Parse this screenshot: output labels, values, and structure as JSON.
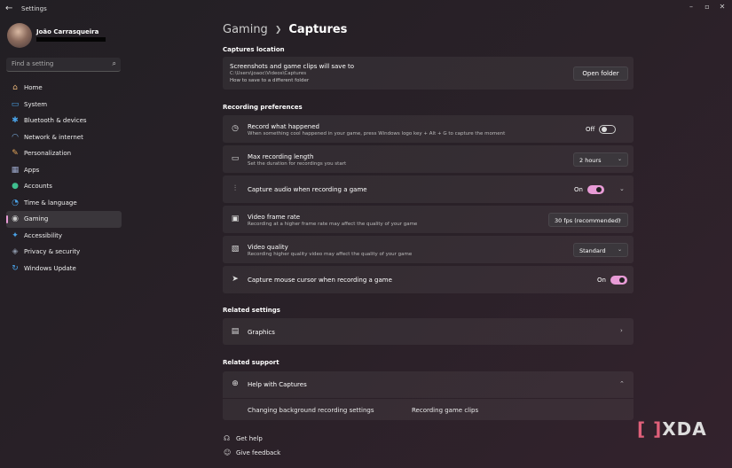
{
  "window": {
    "title": "Settings",
    "back_icon": "back-arrow-icon",
    "controls": [
      "minimize",
      "maximize",
      "close"
    ]
  },
  "profile": {
    "name": "João Carrasqueira"
  },
  "search": {
    "placeholder": "Find a setting"
  },
  "nav": [
    {
      "label": "Home",
      "icon": "home-icon",
      "glyph": "⌂",
      "color": "#e9b67a"
    },
    {
      "label": "System",
      "icon": "system-icon",
      "glyph": "▭",
      "color": "#4aa3e8"
    },
    {
      "label": "Bluetooth & devices",
      "icon": "bluetooth-icon",
      "glyph": "✱",
      "color": "#4aa3e8"
    },
    {
      "label": "Network & internet",
      "icon": "wifi-icon",
      "glyph": "◠",
      "color": "#7fb6ea"
    },
    {
      "label": "Personalization",
      "icon": "brush-icon",
      "glyph": "✎",
      "color": "#e8a85a"
    },
    {
      "label": "Apps",
      "icon": "apps-icon",
      "glyph": "▦",
      "color": "#9aa7c9"
    },
    {
      "label": "Accounts",
      "icon": "accounts-icon",
      "glyph": "●",
      "color": "#3fbf8f"
    },
    {
      "label": "Time & language",
      "icon": "globe-clock-icon",
      "glyph": "◔",
      "color": "#4aa3e8"
    },
    {
      "label": "Gaming",
      "icon": "gamepad-icon",
      "glyph": "◉",
      "color": "#c9c9c9",
      "selected": true
    },
    {
      "label": "Accessibility",
      "icon": "accessibility-icon",
      "glyph": "✦",
      "color": "#4aa3e8"
    },
    {
      "label": "Privacy & security",
      "icon": "shield-icon",
      "glyph": "◈",
      "color": "#8b96a8"
    },
    {
      "label": "Windows Update",
      "icon": "update-icon",
      "glyph": "↻",
      "color": "#4aa3e8"
    }
  ],
  "breadcrumb": {
    "parent": "Gaming",
    "current": "Captures"
  },
  "captures_location": {
    "heading": "Captures location",
    "title": "Screenshots and game clips will save to",
    "path": "C:\\Users\\joaoc\\Videos\\Captures",
    "help_link": "How to save to a different folder",
    "button": "Open folder"
  },
  "recording": {
    "heading": "Recording preferences",
    "record_what_happened": {
      "title": "Record what happened",
      "subtitle": "When something cool happened in your game, press Windows logo key + Alt + G to capture the moment",
      "state": "Off"
    },
    "max_length": {
      "title": "Max recording length",
      "subtitle": "Set the duration for recordings you start",
      "value": "2 hours"
    },
    "capture_audio": {
      "title": "Capture audio when recording a game",
      "state": "On"
    },
    "frame_rate": {
      "title": "Video frame rate",
      "subtitle": "Recording at a higher frame rate may affect the quality of your game",
      "value": "30 fps (recommended)"
    },
    "quality": {
      "title": "Video quality",
      "subtitle": "Recording higher quality video may affect the quality of your game",
      "value": "Standard"
    },
    "mouse_cursor": {
      "title": "Capture mouse cursor when recording a game",
      "state": "On"
    }
  },
  "related_settings": {
    "heading": "Related settings",
    "graphics": "Graphics"
  },
  "related_support": {
    "heading": "Related support",
    "help": "Help with Captures",
    "links": [
      "Changing background recording settings",
      "Recording game clips"
    ]
  },
  "footer": {
    "get_help": "Get help",
    "feedback": "Give feedback"
  },
  "watermark": {
    "text": "XDA"
  },
  "colors": {
    "accent": "#e89bd6"
  }
}
